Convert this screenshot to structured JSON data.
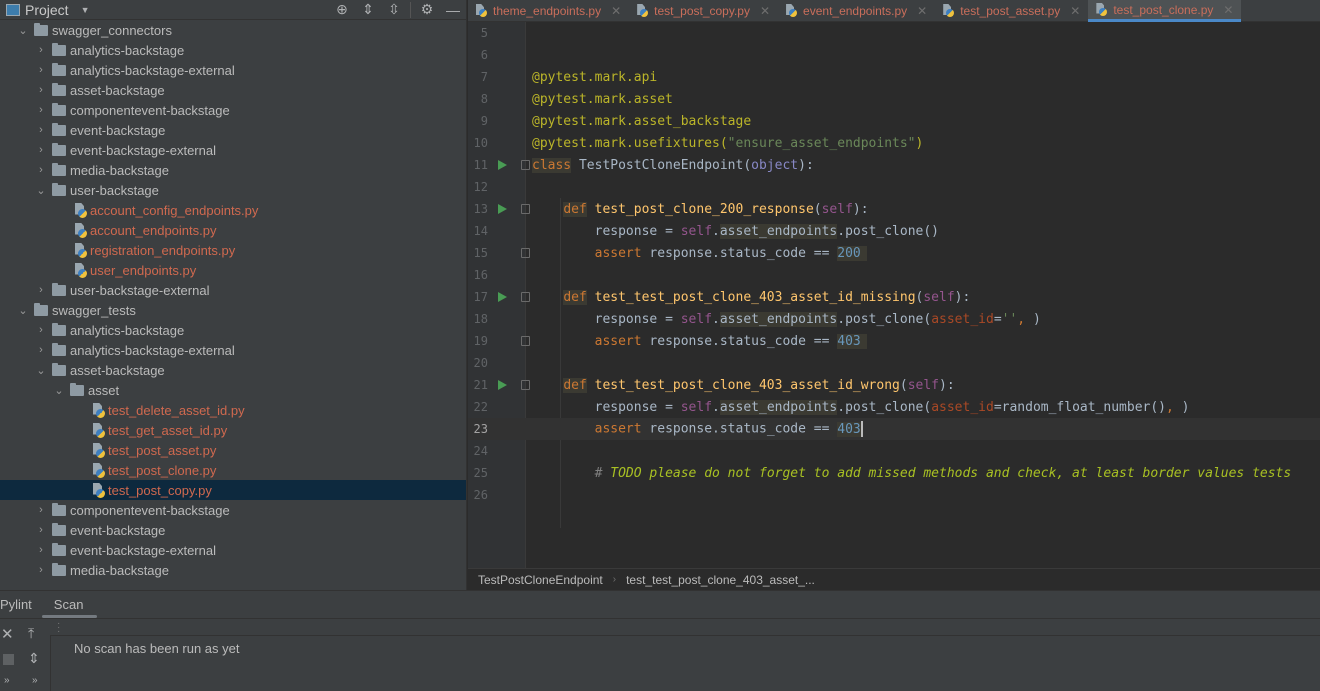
{
  "project_panel": {
    "title": "Project",
    "toolbar": {
      "locate_icon": "crosshair-icon",
      "expand_all_icon": "expand-all-icon",
      "collapse_all_icon": "collapse-all-icon",
      "settings_icon": "gear-icon",
      "hide_icon": "minimize-icon"
    },
    "tree": [
      {
        "label": "swagger_connectors",
        "type": "folder",
        "expanded": true,
        "depth": 1
      },
      {
        "label": "analytics-backstage",
        "type": "folder",
        "expanded": false,
        "depth": 2
      },
      {
        "label": "analytics-backstage-external",
        "type": "folder",
        "expanded": false,
        "depth": 2
      },
      {
        "label": "asset-backstage",
        "type": "folder",
        "expanded": false,
        "depth": 2
      },
      {
        "label": "componentevent-backstage",
        "type": "folder",
        "expanded": false,
        "depth": 2
      },
      {
        "label": "event-backstage",
        "type": "folder",
        "expanded": false,
        "depth": 2
      },
      {
        "label": "event-backstage-external",
        "type": "folder",
        "expanded": false,
        "depth": 2
      },
      {
        "label": "media-backstage",
        "type": "folder",
        "expanded": false,
        "depth": 2
      },
      {
        "label": "user-backstage",
        "type": "folder",
        "expanded": true,
        "depth": 2
      },
      {
        "label": "account_config_endpoints.py",
        "type": "file",
        "depth": 3
      },
      {
        "label": "account_endpoints.py",
        "type": "file",
        "depth": 3
      },
      {
        "label": "registration_endpoints.py",
        "type": "file",
        "depth": 3
      },
      {
        "label": "user_endpoints.py",
        "type": "file",
        "depth": 3
      },
      {
        "label": "user-backstage-external",
        "type": "folder",
        "expanded": false,
        "depth": 2
      },
      {
        "label": "swagger_tests",
        "type": "folder",
        "expanded": true,
        "depth": 1
      },
      {
        "label": "analytics-backstage",
        "type": "folder",
        "expanded": false,
        "depth": 2
      },
      {
        "label": "analytics-backstage-external",
        "type": "folder",
        "expanded": false,
        "depth": 2
      },
      {
        "label": "asset-backstage",
        "type": "folder",
        "expanded": true,
        "depth": 2
      },
      {
        "label": "asset",
        "type": "folder",
        "expanded": true,
        "depth": 3
      },
      {
        "label": "test_delete_asset_id.py",
        "type": "file",
        "depth": 4
      },
      {
        "label": "test_get_asset_id.py",
        "type": "file",
        "depth": 4
      },
      {
        "label": "test_post_asset.py",
        "type": "file",
        "depth": 4
      },
      {
        "label": "test_post_clone.py",
        "type": "file",
        "depth": 4
      },
      {
        "label": "test_post_copy.py",
        "type": "file",
        "depth": 4,
        "selected": true
      },
      {
        "label": "componentevent-backstage",
        "type": "folder",
        "expanded": false,
        "depth": 2
      },
      {
        "label": "event-backstage",
        "type": "folder",
        "expanded": false,
        "depth": 2
      },
      {
        "label": "event-backstage-external",
        "type": "folder",
        "expanded": false,
        "depth": 2
      },
      {
        "label": "media-backstage",
        "type": "folder",
        "expanded": false,
        "depth": 2
      }
    ]
  },
  "editor_tabs": [
    {
      "label": "theme_endpoints.py",
      "active": false
    },
    {
      "label": "test_post_copy.py",
      "active": false
    },
    {
      "label": "event_endpoints.py",
      "active": false
    },
    {
      "label": "test_post_asset.py",
      "active": false
    },
    {
      "label": "test_post_clone.py",
      "active": true
    }
  ],
  "editor": {
    "current_line": 23,
    "lines": [
      {
        "n": "5"
      },
      {
        "n": "6"
      },
      {
        "n": "7",
        "text": "@pytest.mark.api"
      },
      {
        "n": "8",
        "text": "@pytest.mark.asset"
      },
      {
        "n": "9",
        "text": "@pytest.mark.asset_backstage"
      },
      {
        "n": "10",
        "deco": "@pytest.mark.usefixtures(",
        "str": "\"ensure_asset_endpoints\"",
        "close": ")"
      },
      {
        "n": "11",
        "kw": "class",
        "name": " TestPostCloneEndpoint(",
        "base": "object",
        "tail": "):"
      },
      {
        "n": "12"
      },
      {
        "n": "13",
        "kw": "def",
        "fn": "test_post_clone_200_response",
        "self": "self",
        "tail": "):"
      },
      {
        "n": "14",
        "a": "response = ",
        "self": "self",
        "attr": "asset_endpoints",
        "call": ".post_clone()"
      },
      {
        "n": "15",
        "kw": "assert",
        "expr": " response.status_code == ",
        "num": "200"
      },
      {
        "n": "16"
      },
      {
        "n": "17",
        "kw": "def",
        "fn": "test_test_post_clone_403_asset_id_missing",
        "self": "self",
        "tail": "):"
      },
      {
        "n": "18",
        "a": "response = ",
        "self": "self",
        "attr": "asset_endpoints",
        "call": ".post_clone(",
        "param": "asset_id",
        "eq": "=",
        "arg": "''",
        "comma": ", ",
        "close": ")"
      },
      {
        "n": "19",
        "kw": "assert",
        "expr": " response.status_code == ",
        "num": "403"
      },
      {
        "n": "20"
      },
      {
        "n": "21",
        "kw": "def",
        "fn": "test_test_post_clone_403_asset_id_wrong",
        "self": "self",
        "tail": "):"
      },
      {
        "n": "22",
        "a": "response = ",
        "self": "self",
        "attr": "asset_endpoints",
        "call": ".post_clone(",
        "param": "asset_id",
        "eq": "=",
        "arg": "random_float_number()",
        "comma": ", ",
        "close": ")"
      },
      {
        "n": "23",
        "kw": "assert",
        "expr": " response.status_code == ",
        "num": "403"
      },
      {
        "n": "24"
      },
      {
        "n": "25",
        "hash": "# ",
        "todo": "TODO please do not forget to add missed methods and check, at least border values tests"
      },
      {
        "n": "26"
      }
    ]
  },
  "breadcrumb": {
    "class_name": "TestPostCloneEndpoint",
    "method_name": "test_test_post_clone_403_asset_..."
  },
  "bottom_panel": {
    "tabs": [
      {
        "label": "Pylint",
        "active": false
      },
      {
        "label": "Scan",
        "active": true
      }
    ],
    "message": "No scan has been run as yet"
  }
}
